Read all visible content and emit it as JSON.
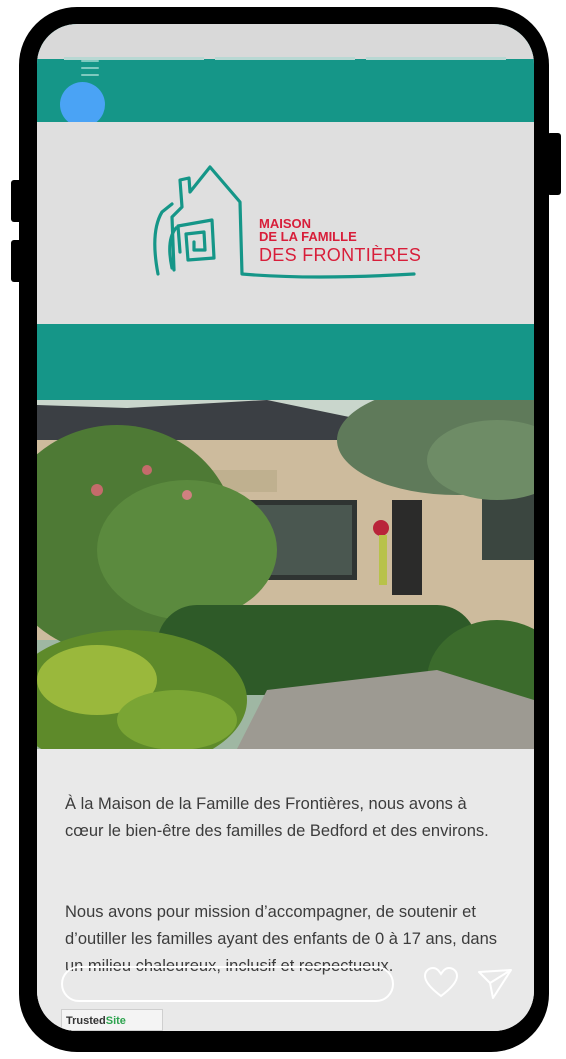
{
  "logo": {
    "line1": "MAISON",
    "line2": "DE LA FAMILLE",
    "line3": "DES FRONTIÈRES",
    "colors": {
      "house": "#159688",
      "text": "#d81e3a"
    }
  },
  "colors": {
    "teal": "#159688",
    "avatar": "#4aa3f5",
    "background": "#dfdfdf",
    "content_background": "#e9e9e9"
  },
  "content": {
    "paragraph1": "À la Maison de la Famille des Frontières, nous avons à cœur le bien-être des familles de Bedford et des environs.",
    "paragraph2": "Nous avons pour mission d’accompagner, de soutenir et d’outiller les familles ayant des enfants de 0 à 17 ans, dans un milieu chaleureux, inclusif et respectueux."
  },
  "footer_badge": {
    "text": "Trusted",
    "highlight": "Site"
  },
  "icons": {
    "menu": "hamburger-icon",
    "profile": "avatar",
    "like": "heart-icon",
    "share": "send-icon"
  }
}
